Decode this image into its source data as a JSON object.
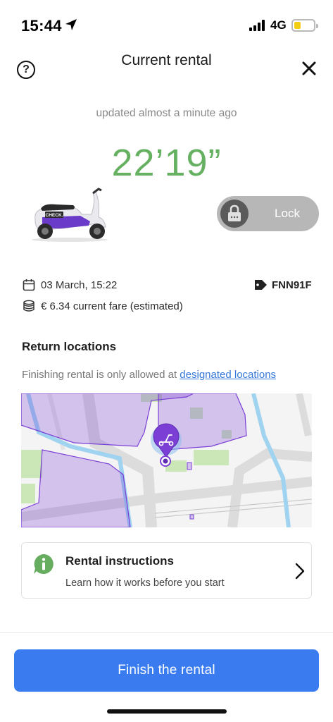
{
  "status_bar": {
    "time": "15:44",
    "network": "4G"
  },
  "header": {
    "title": "Current rental",
    "help_icon": "question-circle-icon",
    "close_icon": "close-icon"
  },
  "rental": {
    "updated_text": "updated almost a minute ago",
    "timer": "22’19”",
    "lock_label": "Lock",
    "start_date": "03 March, 15:22",
    "plate": "FNN91F",
    "fare": "€ 6.34 current fare (estimated)",
    "scooter_brand": "CHECK."
  },
  "return_locations": {
    "title": "Return locations",
    "note_prefix": "Finishing rental is only allowed at ",
    "note_link": "designated locations"
  },
  "instructions_card": {
    "title": "Rental instructions",
    "subtitle": "Learn how it works before you start",
    "icon": "info-bubble-icon"
  },
  "footer": {
    "finish_label": "Finish the rental"
  },
  "colors": {
    "timer_green": "#66b062",
    "primary_blue": "#3a7cf0",
    "link_blue": "#3578d6",
    "zone_purple": "#7b3fd6",
    "battery_yellow": "#f3cc14"
  }
}
